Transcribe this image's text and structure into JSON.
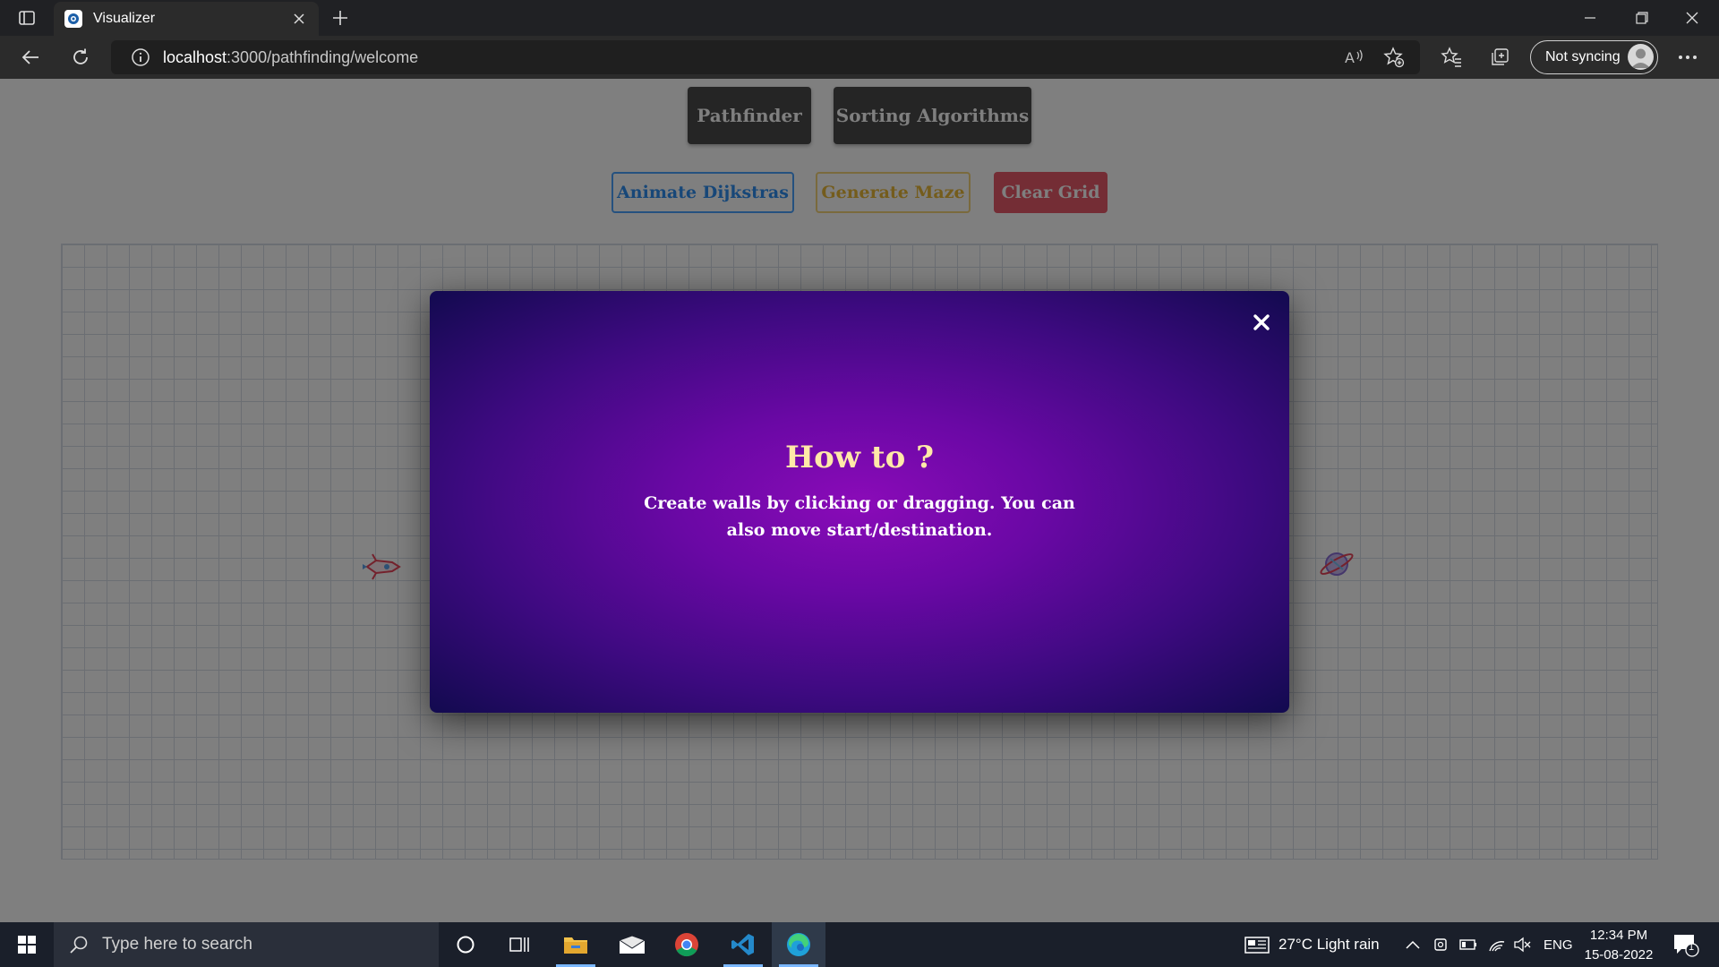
{
  "browser": {
    "tab_title": "Visualizer",
    "url_host": "localhost",
    "url_path": ":3000/pathfinding/welcome",
    "sync_label": "Not syncing"
  },
  "app": {
    "nav": {
      "pathfinder": "Pathfinder",
      "sorting": "Sorting Algorithms"
    },
    "actions": {
      "animate": "Animate Dijkstras",
      "maze": "Generate Maze",
      "clear": "Clear Grid"
    }
  },
  "modal": {
    "title": "How to ?",
    "text": "Create walls by clicking or dragging. You can also move start/destination."
  },
  "taskbar": {
    "search_placeholder": "Type here to search",
    "weather": "27°C  Light rain",
    "language": "ENG",
    "time": "12:34 PM",
    "date": "15-08-2022",
    "notification_count": "1"
  },
  "colors": {
    "animate_border": "#4aa3ff",
    "maze_border": "#f2c94c",
    "clear_bg": "#e85a6a",
    "modal_title": "#ffe9a8"
  }
}
